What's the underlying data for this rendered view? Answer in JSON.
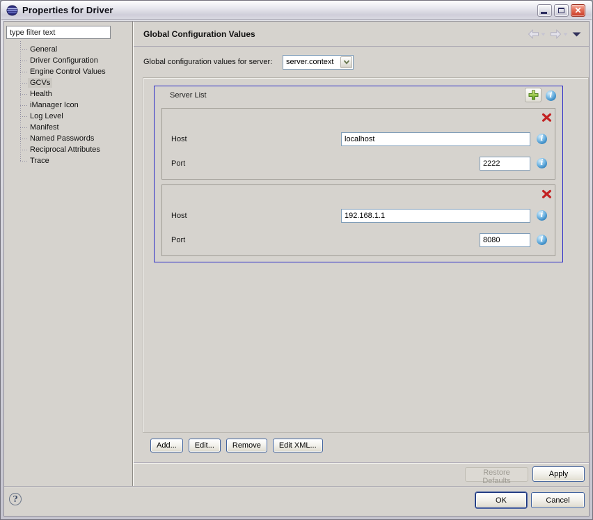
{
  "window": {
    "title": "Properties for Driver"
  },
  "sidebar": {
    "filter_value": "type filter text",
    "tree": [
      {
        "label": "General",
        "selected": false
      },
      {
        "label": "Driver Configuration",
        "selected": false
      },
      {
        "label": "Engine Control Values",
        "selected": false
      },
      {
        "label": "GCVs",
        "selected": true
      },
      {
        "label": "Health",
        "selected": false
      },
      {
        "label": "iManager Icon",
        "selected": false
      },
      {
        "label": "Log Level",
        "selected": false
      },
      {
        "label": "Manifest",
        "selected": false
      },
      {
        "label": "Named Passwords",
        "selected": false
      },
      {
        "label": "Reciprocal Attributes",
        "selected": false
      },
      {
        "label": "Trace",
        "selected": false
      }
    ]
  },
  "header": {
    "title": "Global Configuration Values"
  },
  "server_selector": {
    "label": "Global configuration values for server:",
    "value": "server.context"
  },
  "server_list": {
    "title": "Server List",
    "entries": [
      {
        "host_label": "Host",
        "host_value": "localhost",
        "port_label": "Port",
        "port_value": "2222"
      },
      {
        "host_label": "Host",
        "host_value": "192.168.1.1",
        "port_label": "Port",
        "port_value": "8080"
      }
    ]
  },
  "actions": {
    "add": "Add...",
    "edit": "Edit...",
    "remove": "Remove",
    "edit_xml": "Edit XML..."
  },
  "footer": {
    "restore_defaults": "Restore Defaults",
    "apply": "Apply",
    "ok": "OK",
    "cancel": "Cancel"
  },
  "icons": {
    "help_glyph": "?",
    "info_glyph": "i"
  },
  "colors": {
    "panel_border_blue": "#2a2ac8",
    "delete_red": "#c32222",
    "info_blue": "#3183bf",
    "add_green": "#74a832",
    "input_border": "#7f9db9"
  }
}
